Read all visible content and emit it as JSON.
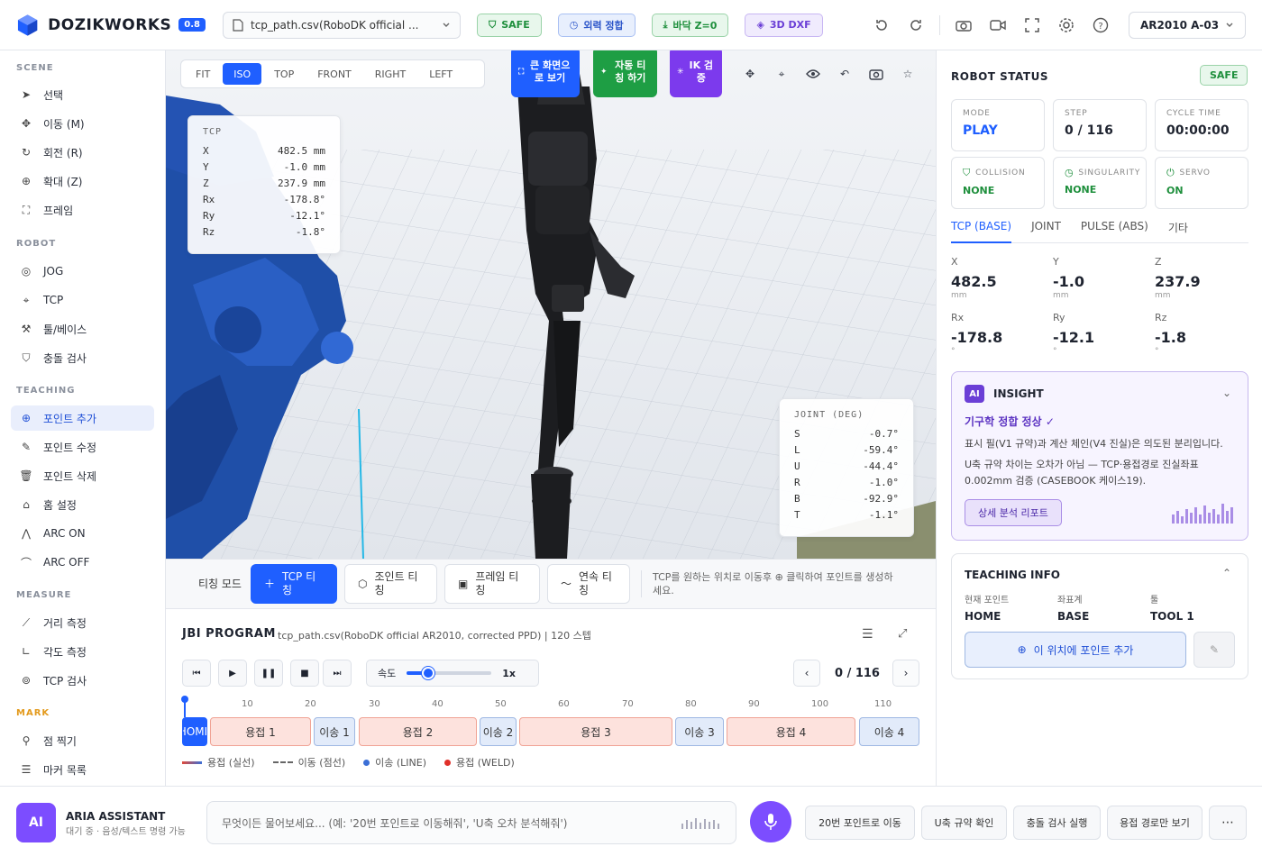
{
  "header": {
    "brand": "DOZIKWORKS",
    "version": "0.8",
    "file_name": "tcp_path.csv(RoboDK official ...",
    "chips": {
      "safe": "SAFE",
      "kinematic": "외력 정합",
      "floor": "바닥 Z=0",
      "dxf": "3D DXF"
    },
    "robot": "AR2010 A-03",
    "colors": {
      "accent": "#1f5fff",
      "safe": "#1e8f3c",
      "purple": "#6b3fd6"
    }
  },
  "sidebar": {
    "sections": {
      "scene": "SCENE",
      "robot": "ROBOT",
      "teaching": "TEACHING",
      "measure": "MEASURE",
      "mark": "MARK"
    },
    "scene_items": [
      {
        "label": "선택",
        "icon": "cursor-icon"
      },
      {
        "label": "이동 (M)",
        "icon": "move-icon"
      },
      {
        "label": "회전 (R)",
        "icon": "rotate-icon"
      },
      {
        "label": "확대 (Z)",
        "icon": "zoom-icon"
      },
      {
        "label": "프레임",
        "icon": "frame-icon"
      }
    ],
    "robot_items": [
      {
        "label": "JOG",
        "icon": "target-icon"
      },
      {
        "label": "TCP",
        "icon": "tcp-icon"
      },
      {
        "label": "툴/베이스",
        "icon": "wrench-icon"
      },
      {
        "label": "충돌 검사",
        "icon": "shield-icon"
      }
    ],
    "teaching_items": [
      {
        "label": "포인트 추가",
        "icon": "plus-circle-icon",
        "active": true
      },
      {
        "label": "포인트 수정",
        "icon": "edit-icon"
      },
      {
        "label": "포인트 삭제",
        "icon": "trash-icon"
      },
      {
        "label": "홈 설정",
        "icon": "home-icon"
      },
      {
        "label": "ARC ON",
        "icon": "arc-on-icon"
      },
      {
        "label": "ARC OFF",
        "icon": "arc-off-icon"
      }
    ],
    "measure_items": [
      {
        "label": "거리 측정",
        "icon": "ruler-icon"
      },
      {
        "label": "각도 측정",
        "icon": "angle-icon"
      },
      {
        "label": "TCP 검사",
        "icon": "crosshair-icon"
      }
    ],
    "mark_items": [
      {
        "label": "점 찍기",
        "icon": "pin-icon"
      },
      {
        "label": "마커 목록",
        "icon": "list-icon"
      }
    ]
  },
  "viewport": {
    "view_tabs": [
      "FIT",
      "ISO",
      "TOP",
      "FRONT",
      "RIGHT",
      "LEFT"
    ],
    "active_view": "ISO",
    "big_buttons": {
      "fullscreen": "큰 화면으로 보기",
      "auto_teach": "자동 티칭 하기",
      "ik_check": "IK 검증"
    },
    "tcp_panel": {
      "title": "TCP",
      "rows": [
        {
          "k": "X",
          "v": "482.5 mm"
        },
        {
          "k": "Y",
          "v": "-1.0 mm"
        },
        {
          "k": "Z",
          "v": "237.9 mm"
        },
        {
          "k": "Rx",
          "v": "-178.8°"
        },
        {
          "k": "Ry",
          "v": "-12.1°"
        },
        {
          "k": "Rz",
          "v": "-1.8°"
        }
      ]
    },
    "joint_panel": {
      "title": "JOINT (DEG)",
      "rows": [
        {
          "k": "S",
          "v": "-0.7°"
        },
        {
          "k": "L",
          "v": "-59.4°"
        },
        {
          "k": "U",
          "v": "-44.4°"
        },
        {
          "k": "R",
          "v": "-1.0°"
        },
        {
          "k": "B",
          "v": "-92.9°"
        },
        {
          "k": "T",
          "v": "-1.1°"
        }
      ]
    }
  },
  "teach_bar": {
    "mode_label": "티칭 모드",
    "buttons": [
      "TCP 티칭",
      "조인트 티칭",
      "프레임 티칭",
      "연속 티칭"
    ],
    "hint": "TCP를 원하는 위치로 이동후 ⊕ 클릭하여 포인트를 생성하세요."
  },
  "program": {
    "title": "JBI PROGRAM",
    "subtitle": "tcp_path.csv(RoboDK official AR2010, corrected PPD) | 120 스텝",
    "speed_label": "속도",
    "speed_value": "1x",
    "speed_fraction": 0.25,
    "step_counter": "0 / 116",
    "ticks": [
      "10",
      "20",
      "30",
      "40",
      "50",
      "60",
      "70",
      "80",
      "90",
      "100",
      "110"
    ],
    "segments": [
      {
        "label": "HOME",
        "kind": "home"
      },
      {
        "label": "용접 1",
        "kind": "weld"
      },
      {
        "label": "이송 1",
        "kind": "move"
      },
      {
        "label": "용접 2",
        "kind": "weld"
      },
      {
        "label": "이송 2",
        "kind": "move"
      },
      {
        "label": "용접 3",
        "kind": "weld"
      },
      {
        "label": "이송 3",
        "kind": "move"
      },
      {
        "label": "용접 4",
        "kind": "weld"
      },
      {
        "label": "이송 4",
        "kind": "move"
      }
    ],
    "legend": [
      "용접 (실선)",
      "이동 (점선)",
      "이송 (LINE)",
      "용접 (WELD)"
    ]
  },
  "robot_status": {
    "title": "ROBOT STATUS",
    "badge": "SAFE",
    "cards": [
      {
        "k": "MODE",
        "v": "PLAY"
      },
      {
        "k": "STEP",
        "v": "0 / 116"
      },
      {
        "k": "CYCLE TIME",
        "v": "00:00:00"
      },
      {
        "k": "COLLISION",
        "v": "NONE"
      },
      {
        "k": "SINGULARITY",
        "v": "NONE"
      },
      {
        "k": "SERVO",
        "v": "ON"
      }
    ],
    "tabs": [
      "TCP (BASE)",
      "JOINT",
      "PULSE (ABS)",
      "기타"
    ],
    "coords": [
      {
        "k": "X",
        "v": "482.5",
        "u": "mm"
      },
      {
        "k": "Y",
        "v": "-1.0",
        "u": "mm"
      },
      {
        "k": "Z",
        "v": "237.9",
        "u": "mm"
      },
      {
        "k": "Rx",
        "v": "-178.8",
        "u": "°"
      },
      {
        "k": "Ry",
        "v": "-12.1",
        "u": "°"
      },
      {
        "k": "Rz",
        "v": "-1.8",
        "u": "°"
      }
    ]
  },
  "insight": {
    "badge": "AI",
    "title": "INSIGHT",
    "headline": "기구학 정합 정상 ✓",
    "line1": "표시 필(V1 규약)과 계산 체인(V4 진실)은 의도된 분리입니다.",
    "line2": "U축 규약 차이는 오차가 아님 — TCP·용접경로 진실좌표 0.002mm 검증 (CASEBOOK 케이스19).",
    "report_button": "상세 분석 리포트"
  },
  "teaching_info": {
    "title": "TEACHING INFO",
    "fields": [
      {
        "k": "현재 포인트",
        "v": "HOME"
      },
      {
        "k": "좌표계",
        "v": "BASE"
      },
      {
        "k": "툴",
        "v": "TOOL 1"
      }
    ],
    "add_button": "이 위치에 포인트 추가"
  },
  "assistant": {
    "badge": "AI",
    "name": "ARIA ASSISTANT",
    "status": "대기 중 · 음성/텍스트 명령 가능",
    "placeholder": "무엇이든 물어보세요... (예: '20번 포인트로 이동해줘', 'U축 오차 분석해줘')",
    "quick_actions": [
      "20번 포인트로 이동",
      "U축 규약 확인",
      "충돌 검사 실행",
      "용접 경로만 보기"
    ],
    "more": "⋯"
  }
}
